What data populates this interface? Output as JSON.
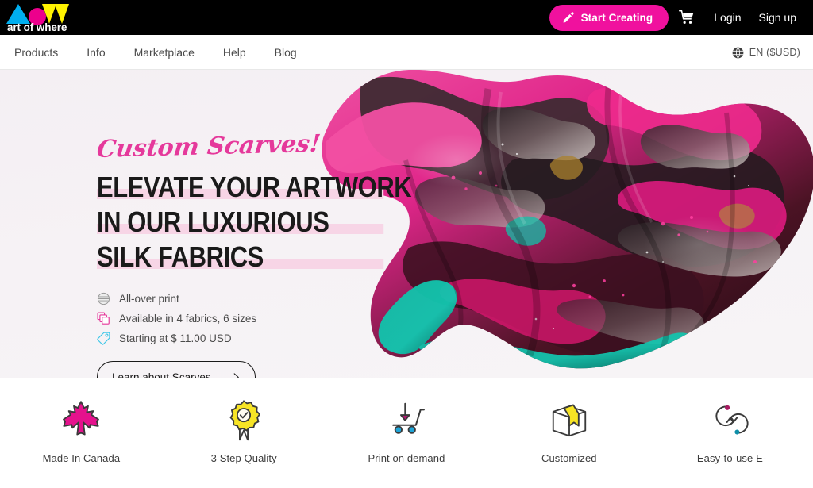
{
  "brand": {
    "logo_text": "art of where",
    "logo_icon": "aow-cmyk-logo",
    "colors": {
      "cyan": "#00AEEF",
      "magenta": "#EC008C",
      "yellow": "#FFF200",
      "pink_accent": "#F0119E"
    }
  },
  "topbar": {
    "start_creating_label": "Start Creating",
    "pencil_icon": "pencil-icon",
    "cart_icon": "shopping-cart-icon",
    "login_label": "Login",
    "signup_label": "Sign up"
  },
  "nav": {
    "items": [
      {
        "label": "Products"
      },
      {
        "label": "Info"
      },
      {
        "label": "Marketplace"
      },
      {
        "label": "Help"
      },
      {
        "label": "Blog"
      }
    ],
    "locale": {
      "icon": "globe-icon",
      "label": "EN ($USD)"
    }
  },
  "hero": {
    "eyebrow": "Custom Scarves!",
    "headline_lines": [
      "ELEVATE YOUR ARTWORK",
      "IN OUR LUXURIOUS",
      "SILK FABRICS"
    ],
    "highlight_color": "#F7D5E6",
    "features": [
      {
        "icon": "all-over-print-icon",
        "label": "All-over print"
      },
      {
        "icon": "fabric-layers-icon",
        "label": "Available in 4 fabrics, 6 sizes"
      },
      {
        "icon": "price-tag-icon",
        "label": "Starting at $ 11.00 USD"
      }
    ],
    "cta_label": "Learn about Scarves",
    "cta_icon": "chevron-right-icon",
    "image_alt": "silk-scarf-photo"
  },
  "value_props": [
    {
      "icon": "maple-leaf-icon",
      "label": "Made In Canada"
    },
    {
      "icon": "quality-badge-icon",
      "label": "3 Step Quality"
    },
    {
      "icon": "print-cart-icon",
      "label": "Print on demand"
    },
    {
      "icon": "gift-box-icon",
      "label": "Customized"
    },
    {
      "icon": "circular-arrows-icon",
      "label": "Easy-to-use E-"
    }
  ]
}
